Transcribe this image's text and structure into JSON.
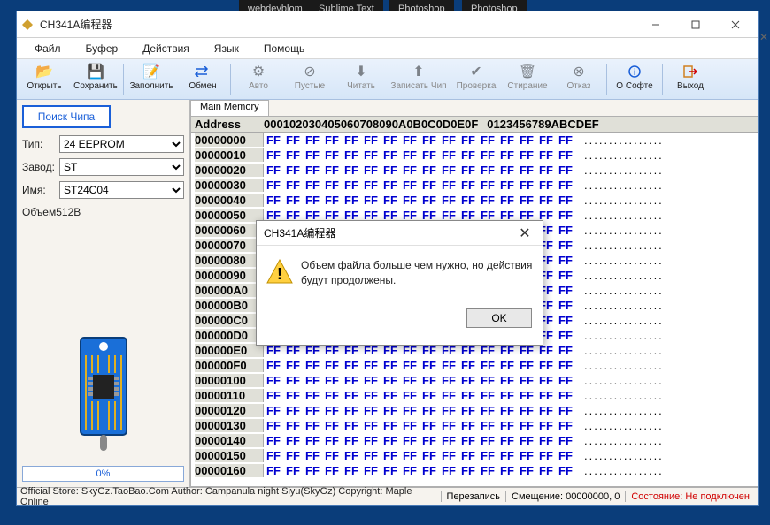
{
  "bg": {
    "tabs": [
      "webdevblom",
      "Sublime Text",
      "Photoshop",
      "Photoshop"
    ]
  },
  "window": {
    "title": "CH341A编程器"
  },
  "menu": [
    "Файл",
    "Буфер",
    "Действия",
    "Язык",
    "Помощь"
  ],
  "toolbar": {
    "open": "Открыть",
    "save": "Сохранить",
    "fill": "Заполнить",
    "swap": "Обмен",
    "auto": "Авто",
    "blank": "Пустые",
    "read": "Читать",
    "write": "Записать Чип",
    "verify": "Проверка",
    "erase": "Стирание",
    "cancel": "Отказ",
    "about": "О Софте",
    "exit": "Выход"
  },
  "side": {
    "search": "Поиск Чипа",
    "type_label": "Тип:",
    "type_value": "24 EEPROM",
    "manu_label": "Завод:",
    "manu_value": "ST",
    "name_label": "Имя:",
    "name_value": "ST24C04",
    "volume": "Объем512B",
    "progress": "0%"
  },
  "main": {
    "tab": "Main Memory",
    "hdr_addr": "Address",
    "hdr_cols": [
      "00",
      "01",
      "02",
      "03",
      "04",
      "05",
      "06",
      "07",
      "08",
      "09",
      "0A",
      "0B",
      "0C",
      "0D",
      "0E",
      "0F"
    ],
    "hdr_ascii": "0123456789ABCDEF",
    "rows": [
      "00000000",
      "00000010",
      "00000020",
      "00000030",
      "00000040",
      "00000050",
      "00000060",
      "00000070",
      "00000080",
      "00000090",
      "000000A0",
      "000000B0",
      "000000C0",
      "000000D0",
      "000000E0",
      "000000F0",
      "00000100",
      "00000110",
      "00000120",
      "00000130",
      "00000140",
      "00000150",
      "00000160"
    ],
    "byte": "FF",
    "ascii_row": "................"
  },
  "status": {
    "left": "Official Store: SkyGz.TaoBao.Com Author: Campanula night Siyu(SkyGz) Copyright: Maple Online",
    "rewrite": "Перезапись",
    "offset": "Смещение: 00000000, 0",
    "state": "Состояние: Не подключен"
  },
  "dialog": {
    "title": "CH341A编程器",
    "message": "Объем файла больше чем нужно, но действия будут продолжены.",
    "ok": "OK"
  }
}
